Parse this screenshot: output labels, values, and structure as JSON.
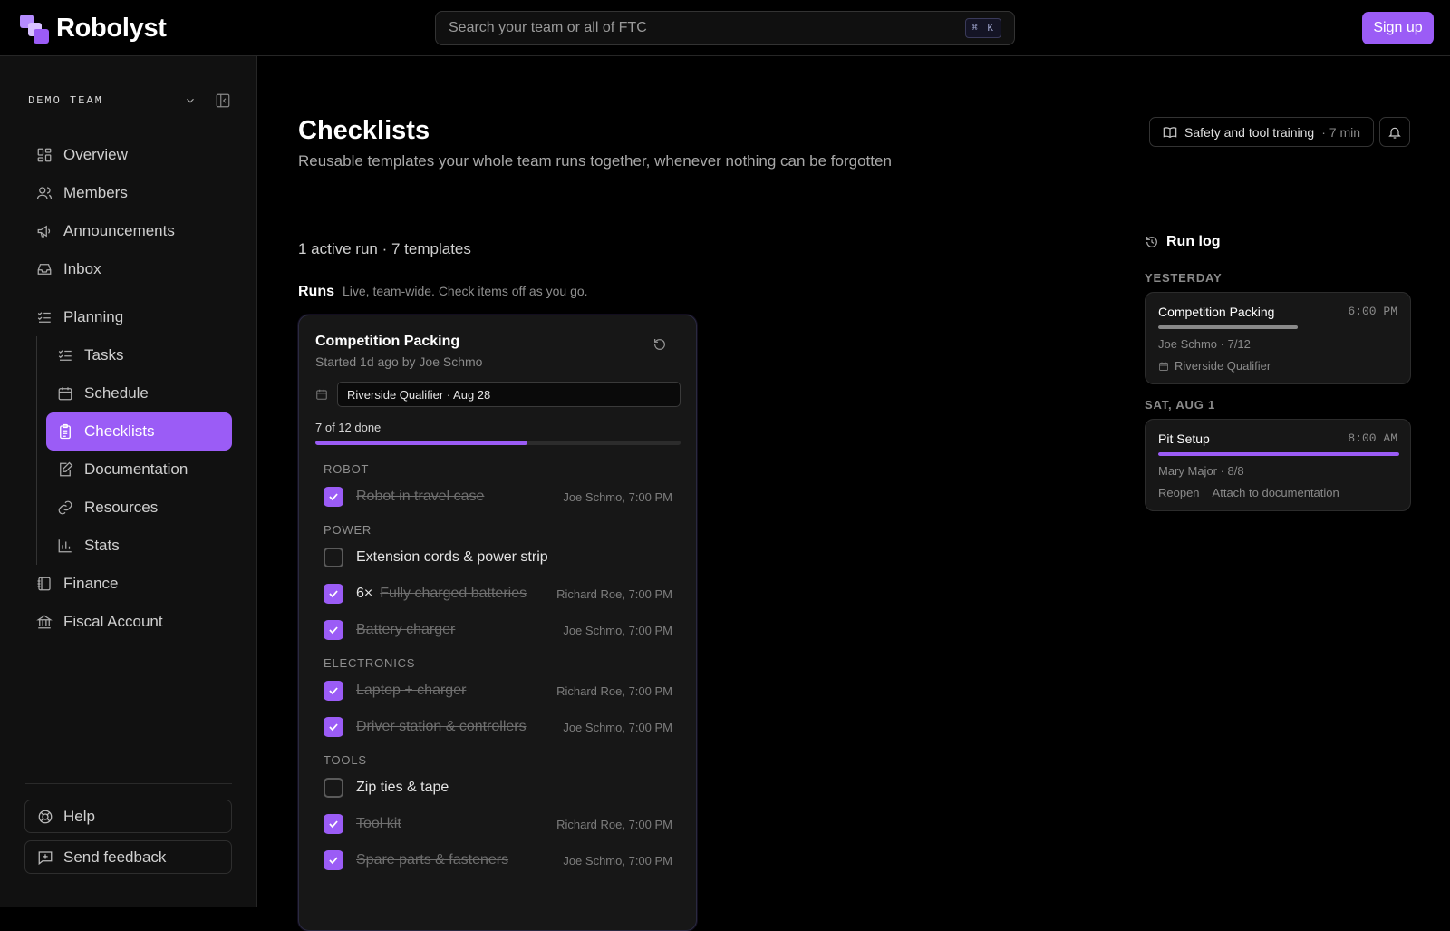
{
  "app": {
    "name": "Robolyst",
    "search_placeholder": "Search your team or all of FTC",
    "search_shortcut": "⌘ K",
    "signup_label": "Sign up",
    "accent": "#9b5cf6"
  },
  "sidebar": {
    "team_name": "DEMO TEAM",
    "items": [
      {
        "label": "Overview",
        "icon": "grid-icon"
      },
      {
        "label": "Members",
        "icon": "users-icon"
      },
      {
        "label": "Announcements",
        "icon": "megaphone-icon"
      },
      {
        "label": "Inbox",
        "icon": "inbox-icon"
      },
      {
        "label": "Planning",
        "icon": "list-check-icon"
      }
    ],
    "planning_items": [
      {
        "label": "Tasks",
        "icon": "list-check-icon"
      },
      {
        "label": "Schedule",
        "icon": "calendar-icon"
      },
      {
        "label": "Checklists",
        "icon": "clipboard-icon",
        "active": true
      },
      {
        "label": "Documentation",
        "icon": "edit-doc-icon"
      },
      {
        "label": "Resources",
        "icon": "link-icon"
      },
      {
        "label": "Stats",
        "icon": "bar-chart-icon"
      }
    ],
    "lower_items": [
      {
        "label": "Finance",
        "icon": "notebook-icon"
      },
      {
        "label": "Fiscal Account",
        "icon": "bank-icon"
      }
    ],
    "help_label": "Help",
    "feedback_label": "Send feedback"
  },
  "main": {
    "title": "Checklists",
    "subtitle": "Reusable templates your whole team runs together, whenever nothing can be forgotten",
    "training_label": "Safety and tool training",
    "training_duration": "· 7 min",
    "counts": "1 active run · 7 templates",
    "runs_title": "Runs",
    "runs_desc": "Live, team-wide. Check items off as you go."
  },
  "run": {
    "title": "Competition Packing",
    "subtitle": "Started 1d ago by Joe Schmo",
    "event": "Riverside Qualifier · Aug 28",
    "progress_label": "7 of 12 done",
    "progress": 0.58,
    "sections": [
      {
        "name": "ROBOT",
        "items": [
          {
            "text": "Robot in travel case",
            "done": true,
            "by": "Joe Schmo, 7:00 PM"
          }
        ]
      },
      {
        "name": "POWER",
        "items": [
          {
            "text": "Extension cords & power strip",
            "done": false,
            "by": ""
          },
          {
            "qty": "6×",
            "text": "Fully charged batteries",
            "done": true,
            "by": "Richard Roe, 7:00 PM"
          },
          {
            "text": "Battery charger",
            "done": true,
            "by": "Joe Schmo, 7:00 PM"
          }
        ]
      },
      {
        "name": "ELECTRONICS",
        "items": [
          {
            "text": "Laptop + charger",
            "done": true,
            "by": "Richard Roe, 7:00 PM"
          },
          {
            "text": "Driver station & controllers",
            "done": true,
            "by": "Joe Schmo, 7:00 PM"
          }
        ]
      },
      {
        "name": "TOOLS",
        "items": [
          {
            "text": "Zip ties & tape",
            "done": false,
            "by": ""
          },
          {
            "text": "Tool kit",
            "done": true,
            "by": "Richard Roe, 7:00 PM"
          },
          {
            "text": "Spare parts & fasteners",
            "done": true,
            "by": "Joe Schmo, 7:00 PM"
          }
        ]
      }
    ]
  },
  "run_log": {
    "title": "Run log",
    "days": [
      {
        "label": "YESTERDAY",
        "entries": [
          {
            "title": "Competition Packing",
            "time": "6:00 PM",
            "progress": 0.58,
            "bar_color": "#8a8a8a",
            "meta": "Joe Schmo · 7/12",
            "event": "Riverside Qualifier"
          }
        ]
      },
      {
        "label": "SAT, AUG 1",
        "entries": [
          {
            "title": "Pit Setup",
            "time": "8:00 AM",
            "progress": 1.0,
            "bar_color": "#9b5cf6",
            "meta": "Mary Major · 8/8",
            "actions": [
              "Reopen",
              "Attach to documentation"
            ]
          }
        ]
      }
    ]
  }
}
